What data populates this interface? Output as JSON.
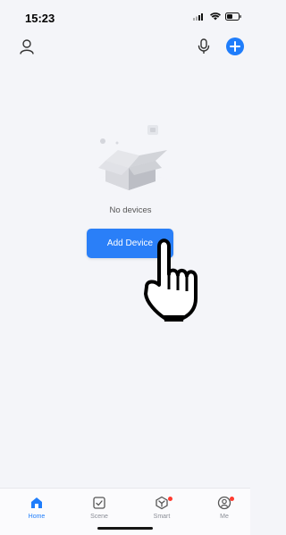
{
  "status_bar": {
    "time": "15:23",
    "icons": [
      "cellular-signal-icon",
      "wifi-icon",
      "battery-icon"
    ]
  },
  "header": {
    "icons": [
      "profile-icon",
      "microphone-icon",
      "add-icon"
    ]
  },
  "empty_state": {
    "message": "No devices",
    "button_label": "Add Device"
  },
  "tabbar": {
    "items": [
      {
        "label": "Home",
        "icon": "home-icon",
        "active": true
      },
      {
        "label": "Scene",
        "icon": "scene-icon",
        "active": false
      },
      {
        "label": "Smart",
        "icon": "smart-icon",
        "active": false
      },
      {
        "label": "Me",
        "icon": "me-icon",
        "active": false
      }
    ]
  },
  "colors": {
    "accent": "#1f7dfb",
    "background": "#f4f5f9",
    "badge": "#ff3b30"
  }
}
